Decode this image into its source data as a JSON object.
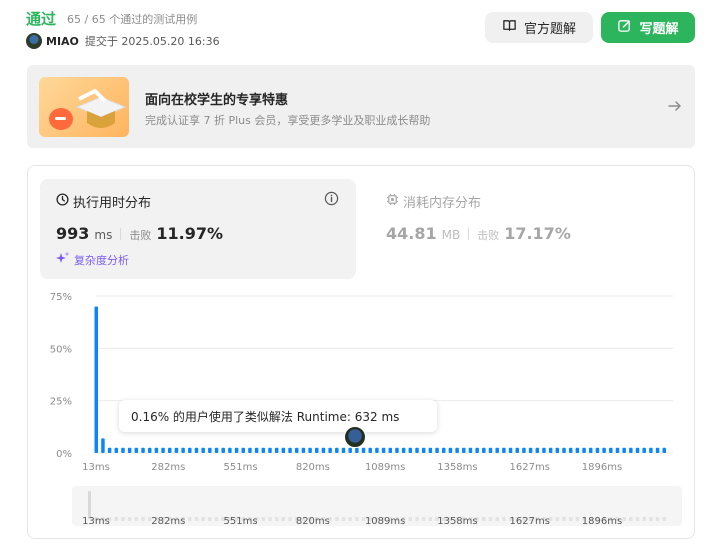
{
  "header": {
    "status": "通过",
    "passed": "65 / 65 个通过的测试用例",
    "username": "MIAO",
    "submitted": "提交于 2025.05.20 16:36",
    "official_label": "官方题解",
    "write_label": "写题解"
  },
  "banner": {
    "title": "面向在校学生的专享特惠",
    "subtitle": "完成认证享 7 折 Plus 会员，享受更多学业及职业成长帮助"
  },
  "runtime": {
    "title": "执行用时分布",
    "value": "993",
    "unit": "ms",
    "beat_label": "击败",
    "beat_value": "11.97%",
    "complexity_label": "复杂度分析"
  },
  "memory": {
    "title": "消耗内存分布",
    "value": "44.81",
    "unit": "MB",
    "beat_label": "击败",
    "beat_value": "17.17%"
  },
  "tooltip": "0.16% 的用户使用了类似解法 Runtime: 632 ms",
  "colors": {
    "accent": "#2db55d",
    "bar": "#0a84ff",
    "complexity": "#7b5cf0"
  },
  "chart_data": {
    "type": "bar",
    "ytick_labels": [
      "75%",
      "50%",
      "25%",
      "0%"
    ],
    "ylim": [
      0,
      75
    ],
    "xtick_labels": [
      "13ms",
      "282ms",
      "551ms",
      "820ms",
      "1089ms",
      "1358ms",
      "1627ms",
      "1896ms"
    ],
    "values": [
      70,
      7,
      2.5,
      2.5,
      2.5,
      2.5,
      2.5,
      2.5,
      2.5,
      2.5,
      2.5,
      2.5,
      2.5,
      2.5,
      2.5,
      2.5,
      2.5,
      2.5,
      2.5,
      2.5,
      2.5,
      2.5,
      2.5,
      2.5,
      2.5,
      2.5,
      2.5,
      2.5,
      2.5,
      2.5,
      2.5,
      2.5,
      2.5,
      2.5,
      2.5,
      2.5,
      2.5,
      2.5,
      2.5,
      2.5,
      2.5,
      2.5,
      2.5,
      2.5,
      2.5,
      2.5,
      2.5,
      2.5,
      2.5,
      2.5,
      2.5,
      2.5,
      2.5,
      2.5,
      2.5,
      2.5,
      2.5,
      2.5,
      2.5,
      2.5,
      2.5,
      2.5,
      2.5,
      2.5,
      2.5,
      2.5,
      2.5,
      2.5,
      2.5,
      2.5,
      2.5,
      2.5,
      2.5,
      2.5,
      2.5,
      2.5,
      2.5,
      2.5,
      2.5,
      2.5,
      2.5,
      2.5,
      2.5,
      2.5,
      2.5,
      2.5
    ]
  }
}
